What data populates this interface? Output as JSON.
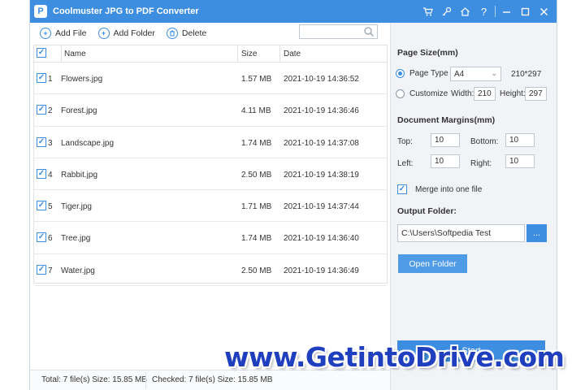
{
  "app": {
    "title": "Coolmuster JPG to PDF Converter",
    "accent_color": "#3d8ee0",
    "title_icons": [
      "cart-icon",
      "key-icon",
      "home-icon",
      "help-icon",
      "minimize-icon",
      "maximize-icon",
      "close-icon"
    ]
  },
  "toolbar": {
    "add_file": "Add File",
    "add_folder": "Add Folder",
    "delete": "Delete",
    "search_value": ""
  },
  "list": {
    "headers": {
      "name": "Name",
      "size": "Size",
      "date": "Date"
    },
    "rows": [
      {
        "num": "1",
        "name": "Flowers.jpg",
        "size": "1.57 MB",
        "date": "2021-10-19 14:36:52",
        "checked": true
      },
      {
        "num": "2",
        "name": "Forest.jpg",
        "size": "4.11 MB",
        "date": "2021-10-19 14:36:46",
        "checked": true
      },
      {
        "num": "3",
        "name": "Landscape.jpg",
        "size": "1.74 MB",
        "date": "2021-10-19 14:37:08",
        "checked": true
      },
      {
        "num": "4",
        "name": "Rabbit.jpg",
        "size": "2.50 MB",
        "date": "2021-10-19 14:38:19",
        "checked": true
      },
      {
        "num": "5",
        "name": "Tiger.jpg",
        "size": "1.71 MB",
        "date": "2021-10-19 14:37:44",
        "checked": true
      },
      {
        "num": "6",
        "name": "Tree.jpg",
        "size": "1.74 MB",
        "date": "2021-10-19 14:36:40",
        "checked": true
      },
      {
        "num": "7",
        "name": "Water.jpg",
        "size": "2.50 MB",
        "date": "2021-10-19 14:36:49",
        "checked": true
      }
    ]
  },
  "status": {
    "total": "Total: 7 file(s) Size: 15.85 MB",
    "checked": "Checked: 7 file(s) Size: 15.85 MB"
  },
  "panel": {
    "page_size_title": "Page Size(mm)",
    "page_type_label": "Page Type",
    "page_type_value": "A4",
    "page_type_dims": "210*297",
    "customize_label": "Customize",
    "width_label": "Width:",
    "width_value": "210",
    "height_label": "Height:",
    "height_value": "297",
    "margins_title": "Document Margins(mm)",
    "top_label": "Top:",
    "top_value": "10",
    "bottom_label": "Bottom:",
    "bottom_value": "10",
    "left_label": "Left:",
    "left_value": "10",
    "right_label": "Right:",
    "right_value": "10",
    "merge_label": "Merge into one file",
    "merge_checked": true,
    "output_title": "Output Folder:",
    "output_path": "C:\\Users\\Softpedia Test",
    "browse_label": "...",
    "open_folder": "Open Folder",
    "start": "Start"
  },
  "watermark": "www.GetintoDrive.com"
}
